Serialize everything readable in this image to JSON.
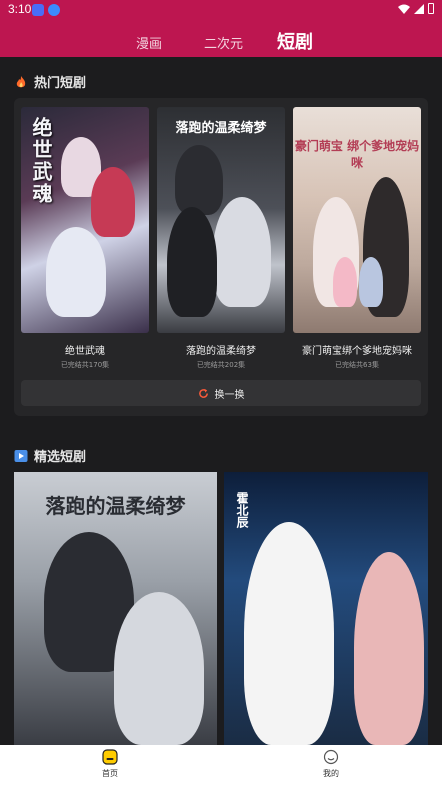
{
  "status": {
    "time": "3:10"
  },
  "header": {
    "tabs": [
      {
        "label": "漫画"
      },
      {
        "label": "二次元"
      },
      {
        "label": "短剧"
      }
    ]
  },
  "hot": {
    "title": "热门短剧",
    "items": [
      {
        "poster_title": "绝世武魂",
        "name": "绝世武魂",
        "episodes": "已完结共170集"
      },
      {
        "poster_title": "落跑的温柔绮梦",
        "name": "落跑的温柔绮梦",
        "episodes": "已完结共202集"
      },
      {
        "poster_title": "豪门萌宝 绑个爹地宠妈咪",
        "name": "豪门萌宝绑个爹地宠妈咪",
        "episodes": "已完结共63集"
      }
    ],
    "refresh_label": "换一换"
  },
  "featured": {
    "title": "精选短剧",
    "items": [
      {
        "poster_title": "落跑的温柔绮梦"
      },
      {
        "poster_title": "霍北辰"
      }
    ]
  },
  "bottom_nav": {
    "items": [
      {
        "label": "首页"
      },
      {
        "label": "我的"
      }
    ]
  },
  "colors": {
    "accent": "#bd1650",
    "background": "#1c1c1e"
  }
}
